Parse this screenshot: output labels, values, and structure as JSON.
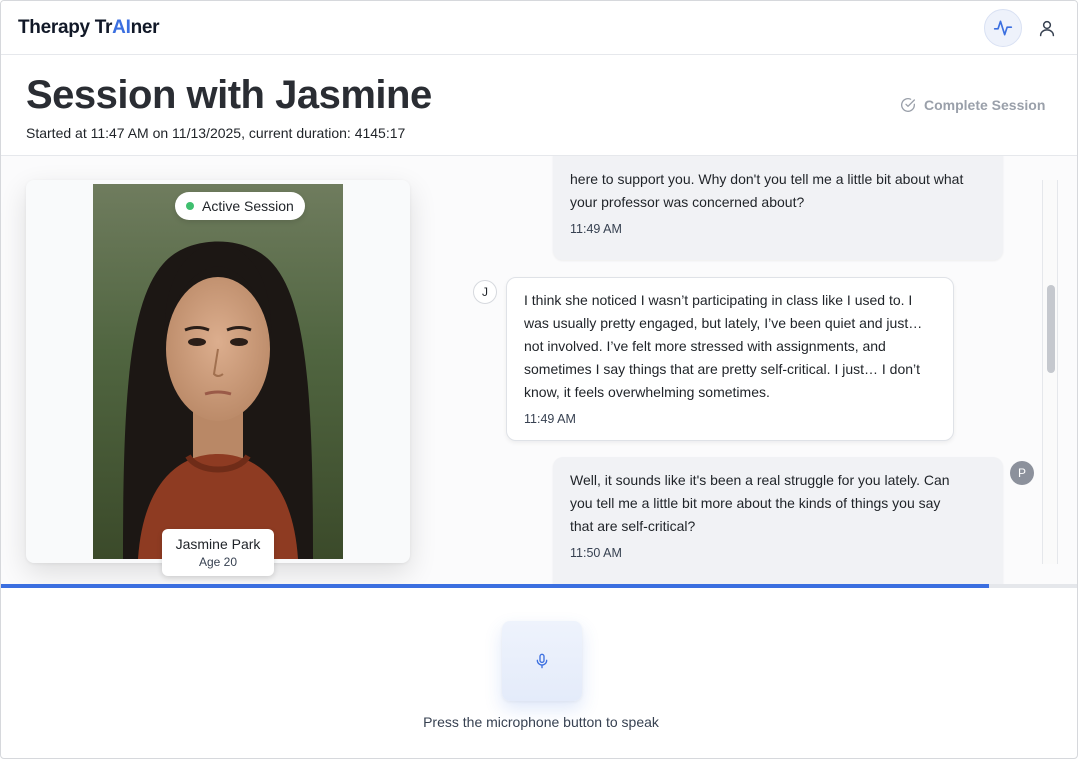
{
  "app": {
    "logo_prefix": "Therapy Tr",
    "logo_accent": "AI",
    "logo_suffix": "ner"
  },
  "topbar": {
    "activity_icon": "activity-icon",
    "user_icon": "user-icon"
  },
  "header": {
    "title": "Session with Jasmine",
    "subtitle": "Started at 11:47 AM on 11/13/2025, current duration: 4145:17",
    "complete_label": "Complete Session"
  },
  "client": {
    "status": "Active Session",
    "name": "Jasmine Park",
    "age": "Age 20"
  },
  "chat": {
    "messages": [
      {
        "sender": "therapist",
        "avatar": "P",
        "lines": [
          "here to support you. Why don't you tell me a little bit about what",
          "your professor was concerned about?"
        ],
        "time": "11:49 AM"
      },
      {
        "sender": "client",
        "avatar": "J",
        "lines": [
          "I think she noticed I wasn’t participating in class like I used to. I",
          "was usually pretty engaged, but lately, I’ve been quiet and just…",
          "not involved. I’ve felt more stressed with assignments, and",
          "sometimes I say things that are pretty self-critical. I just… I don’t",
          "know, it feels overwhelming sometimes."
        ],
        "time": "11:49 AM"
      },
      {
        "sender": "therapist",
        "avatar": "P",
        "lines": [
          "Well, it sounds like it's been a real struggle for you lately. Can",
          "you tell me a little bit more about the kinds of things you say",
          "that are self-critical?"
        ],
        "time": "11:50 AM"
      }
    ]
  },
  "session_progress": 0.918,
  "footer": {
    "mic_icon": "microphone-icon",
    "hint": "Press the microphone button to speak"
  },
  "colors": {
    "accent": "#3b6fe0",
    "active_status": "#3fbf6f"
  }
}
